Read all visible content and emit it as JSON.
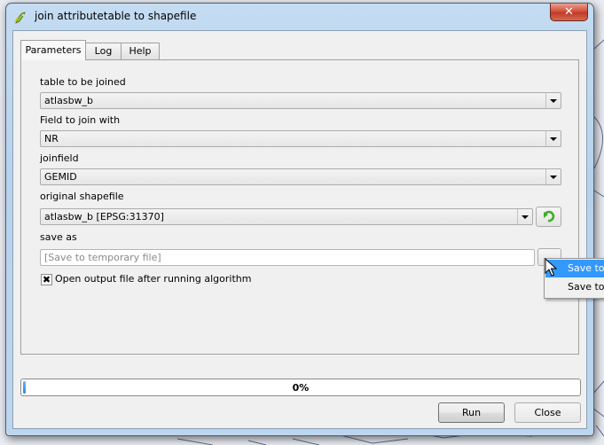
{
  "window": {
    "title": "join attributetable to shapefile",
    "close_glyph": "✕"
  },
  "tabs": [
    {
      "label": "Parameters",
      "active": true
    },
    {
      "label": "Log",
      "active": false
    },
    {
      "label": "Help",
      "active": false
    }
  ],
  "parameters": {
    "table_label": "table to be joined",
    "table_value": "atlasbw_b",
    "field_label": "Field to join with",
    "field_value": "NR",
    "joinfield_label": "joinfield",
    "joinfield_value": "GEMID",
    "shapefile_label": "original shapefile",
    "shapefile_value": "atlasbw_b [EPSG:31370]",
    "saveas_label": "save as",
    "saveas_value": "",
    "saveas_placeholder": "[Save to temporary file]",
    "browse_label": "...",
    "open_output_label": "Open output file after running algorithm",
    "open_output_checked": true,
    "checkbox_glyph": "✖"
  },
  "save_menu": {
    "items": [
      {
        "label": "Save to temporary file",
        "highlighted": true
      },
      {
        "label": "Save to file...",
        "highlighted": false
      }
    ]
  },
  "progress": {
    "value_percent": 0,
    "text": "0%"
  },
  "buttons": {
    "run": "Run",
    "close": "Close"
  },
  "colors": {
    "accent": "#3399ff",
    "refresh_icon": "#3fae2a",
    "close_button": "#c9442f"
  }
}
